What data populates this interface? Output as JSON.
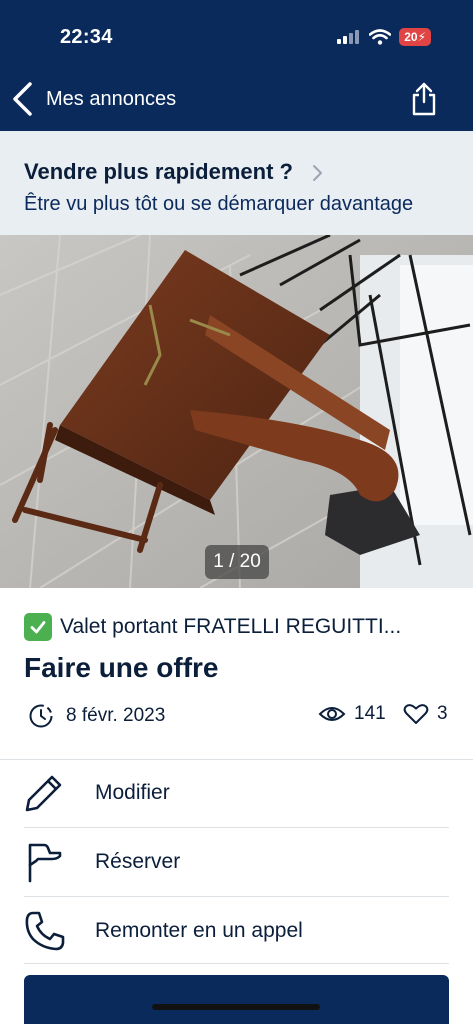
{
  "status_bar": {
    "time": "22:34",
    "battery": "20"
  },
  "nav": {
    "back_label": "Mes annonces",
    "back_icon": "chevron-left-icon",
    "share_icon": "share-icon"
  },
  "promo": {
    "title": "Vendre plus rapidement ?",
    "subtitle": "Être vu plus tôt ou se démarquer davantage"
  },
  "photo": {
    "counter": "1 / 20",
    "current": 1,
    "total": 20
  },
  "listing": {
    "title": "Valet portant  FRATELLI REGUITTI...",
    "price": "Faire une offre",
    "date": "8 févr. 2023",
    "views": "141",
    "likes": "3"
  },
  "actions": [
    {
      "label": "Modifier",
      "icon": "pencil-icon"
    },
    {
      "label": "Réserver",
      "icon": "flag-icon"
    },
    {
      "label": "Remonter en un appel",
      "icon": "phone-icon"
    }
  ],
  "colors": {
    "header": "#0b2a5c",
    "promo_bg": "#e9eef3",
    "text": "#0b1e3a",
    "check": "#4caf50",
    "battery": "#e04444"
  }
}
